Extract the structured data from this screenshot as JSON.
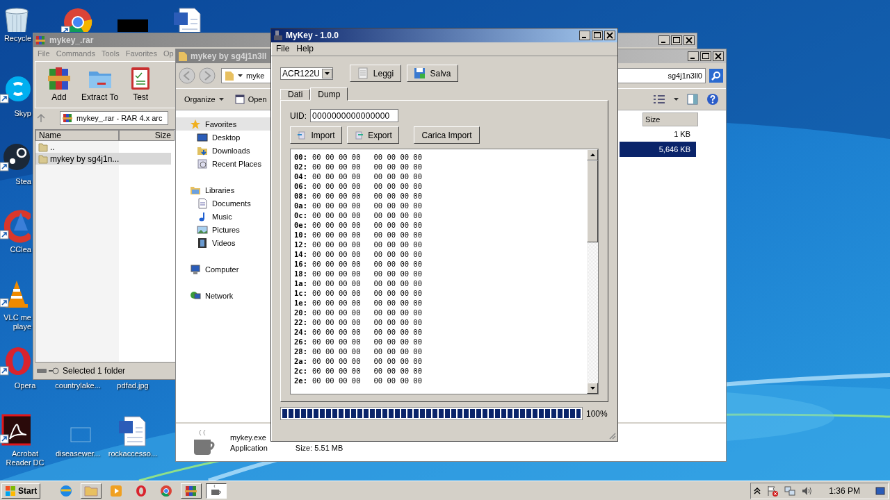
{
  "desktop": {
    "icons": [
      {
        "kind": "bin",
        "label": "Recycle"
      },
      {
        "kind": "browser"
      },
      {
        "kind": "dark"
      },
      {
        "kind": "doc"
      },
      {
        "kind": "chat",
        "label": "Skyp"
      },
      {
        "kind": "game",
        "label": "Stea"
      },
      {
        "kind": "cleaner",
        "label": "CClea"
      },
      {
        "kind": "cone",
        "label": "VLC me playe"
      },
      {
        "kind": "ring",
        "label": "Opera"
      },
      {
        "kind": "none",
        "label": "countrylake..."
      },
      {
        "kind": "none",
        "label": "pdfad.jpg"
      },
      {
        "kind": "reader",
        "label": "Acrobat Reader DC"
      },
      {
        "kind": "faint",
        "label": "diseasewer..."
      },
      {
        "kind": "doc",
        "label": "rockaccesso..."
      }
    ]
  },
  "winrar": {
    "title": "mykey_.rar",
    "menu": [
      "File",
      "Commands",
      "Tools",
      "Favorites",
      "Op"
    ],
    "tools": [
      {
        "kind": "add",
        "label": "Add"
      },
      {
        "kind": "extract",
        "label": "Extract To"
      },
      {
        "kind": "test",
        "label": "Test"
      }
    ],
    "address": "mykey_.rar - RAR 4.x arc",
    "columns": [
      "Name",
      "Size"
    ],
    "rows": [
      {
        "name": "..",
        "selected": false
      },
      {
        "name": "mykey by sg4j1n...",
        "selected": true
      }
    ],
    "status": "Selected 1 folder"
  },
  "explorer": {
    "title": "mykey by sg4j1n3ll",
    "address_left": "myke",
    "address_right": "sg4j1n3ll0",
    "toolbar": [
      {
        "kind": "menu",
        "label": "Organize"
      },
      {
        "kind": "open",
        "label": "Open"
      }
    ],
    "nav": [
      {
        "kind": "star",
        "label": "Favorites",
        "selected": true,
        "children": [
          {
            "kind": "desktop",
            "label": "Desktop",
            "selected": false
          },
          {
            "kind": "download",
            "label": "Downloads",
            "selected": false
          },
          {
            "kind": "recent",
            "label": "Recent Places",
            "selected": false
          }
        ]
      },
      {
        "kind": "library",
        "label": "Libraries",
        "selected": false,
        "children": [
          {
            "kind": "document",
            "label": "Documents",
            "selected": false
          },
          {
            "kind": "music",
            "label": "Music",
            "selected": false
          },
          {
            "kind": "picture",
            "label": "Pictures",
            "selected": false
          },
          {
            "kind": "video",
            "label": "Videos",
            "selected": false
          }
        ]
      },
      {
        "kind": "computer",
        "label": "Computer",
        "selected": false
      },
      {
        "kind": "network",
        "label": "Network",
        "selected": false
      }
    ],
    "size_column": "Size",
    "files": [
      {
        "size": "1 KB",
        "selected": false
      },
      {
        "size": "5,646 KB",
        "selected": true
      }
    ],
    "details": {
      "name": "mykey.exe",
      "type": "Application",
      "size": "Size: 5.51 MB"
    }
  },
  "mykey": {
    "title": "MyKey - 1.0.0",
    "menu": [
      "File",
      "Help"
    ],
    "reader": "ACR122U",
    "buttons": [
      {
        "kind": "read",
        "label": "Leggi"
      },
      {
        "kind": "save",
        "label": "Salva"
      }
    ],
    "tabs": [
      {
        "label": "Dati",
        "selected": false
      },
      {
        "label": "Dump",
        "selected": true
      }
    ],
    "uid_label": "UID:",
    "uid": "0000000000000000",
    "actions": [
      {
        "kind": "import",
        "label": "Import"
      },
      {
        "kind": "export",
        "label": "Export"
      },
      {
        "kind": "plain",
        "label": "Carica Import"
      }
    ],
    "dump": [
      {
        "address": "00:",
        "bytes": "00 00 00 00   00 00 00 00"
      },
      {
        "address": "02:",
        "bytes": "00 00 00 00   00 00 00 00"
      },
      {
        "address": "04:",
        "bytes": "00 00 00 00   00 00 00 00"
      },
      {
        "address": "06:",
        "bytes": "00 00 00 00   00 00 00 00"
      },
      {
        "address": "08:",
        "bytes": "00 00 00 00   00 00 00 00"
      },
      {
        "address": "0a:",
        "bytes": "00 00 00 00   00 00 00 00"
      },
      {
        "address": "0c:",
        "bytes": "00 00 00 00   00 00 00 00"
      },
      {
        "address": "0e:",
        "bytes": "00 00 00 00   00 00 00 00"
      },
      {
        "address": "10:",
        "bytes": "00 00 00 00   00 00 00 00"
      },
      {
        "address": "12:",
        "bytes": "00 00 00 00   00 00 00 00"
      },
      {
        "address": "14:",
        "bytes": "00 00 00 00   00 00 00 00"
      },
      {
        "address": "16:",
        "bytes": "00 00 00 00   00 00 00 00"
      },
      {
        "address": "18:",
        "bytes": "00 00 00 00   00 00 00 00"
      },
      {
        "address": "1a:",
        "bytes": "00 00 00 00   00 00 00 00"
      },
      {
        "address": "1c:",
        "bytes": "00 00 00 00   00 00 00 00"
      },
      {
        "address": "1e:",
        "bytes": "00 00 00 00   00 00 00 00"
      },
      {
        "address": "20:",
        "bytes": "00 00 00 00   00 00 00 00"
      },
      {
        "address": "22:",
        "bytes": "00 00 00 00   00 00 00 00"
      },
      {
        "address": "24:",
        "bytes": "00 00 00 00   00 00 00 00"
      },
      {
        "address": "26:",
        "bytes": "00 00 00 00   00 00 00 00"
      },
      {
        "address": "28:",
        "bytes": "00 00 00 00   00 00 00 00"
      },
      {
        "address": "2a:",
        "bytes": "00 00 00 00   00 00 00 00"
      },
      {
        "address": "2c:",
        "bytes": "00 00 00 00   00 00 00 00"
      },
      {
        "address": "2e:",
        "bytes": "00 00 00 00   00 00 00 00"
      }
    ],
    "progress": {
      "level": 1,
      "reading": "100%"
    }
  },
  "taskbar": {
    "start": "Start",
    "apps": [
      {
        "kind": "ie",
        "open": false,
        "pressed": false
      },
      {
        "kind": "folder",
        "open": true,
        "pressed": false
      },
      {
        "kind": "media",
        "open": false,
        "pressed": false
      },
      {
        "kind": "ring",
        "open": false,
        "pressed": false
      },
      {
        "kind": "browser",
        "open": false,
        "pressed": false
      },
      {
        "kind": "archive",
        "open": true,
        "pressed": false
      },
      {
        "kind": "cup",
        "open": true,
        "pressed": true
      }
    ],
    "clock": "1:36 PM"
  }
}
